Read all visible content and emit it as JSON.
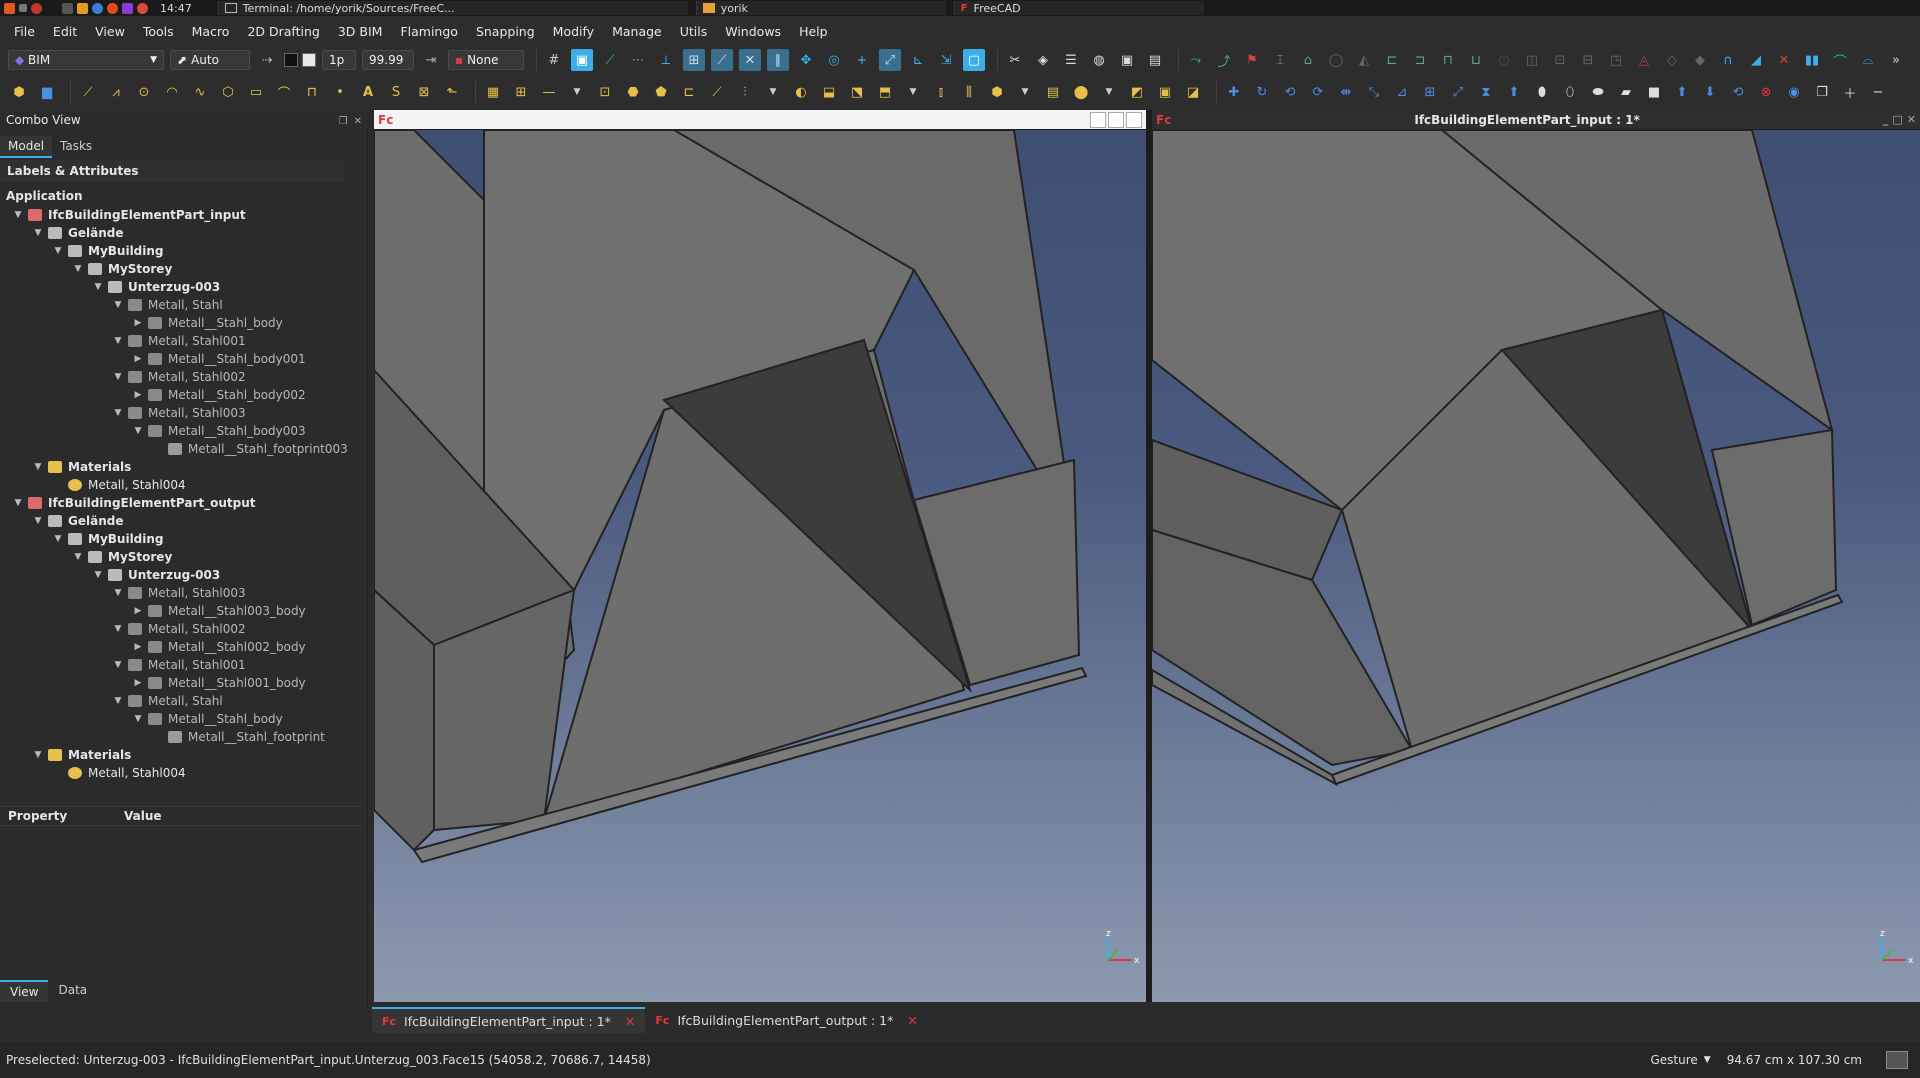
{
  "system": {
    "clock": "14:47",
    "terminal_task": "Terminal: /home/yorik/Sources/FreeC...",
    "folder_task": "yorik",
    "freecad_task": "FreeCAD"
  },
  "menu": [
    "File",
    "Edit",
    "View",
    "Tools",
    "Macro",
    "2D Drafting",
    "3D BIM",
    "Flamingo",
    "Snapping",
    "Modify",
    "Manage",
    "Utils",
    "Windows",
    "Help"
  ],
  "toolbar": {
    "workbench": "BIM",
    "mode": "Auto",
    "line_width": "1p",
    "font_size": "99.99",
    "snap_none": "None"
  },
  "combo_view": {
    "title": "Combo View",
    "tabs": [
      "Model",
      "Tasks"
    ],
    "section_title": "Labels & Attributes",
    "root_label": "Application",
    "tree": [
      {
        "label": "IfcBuildingElementPart_input",
        "level": 0,
        "expanded": true,
        "icon": "document-icon",
        "bold": true
      },
      {
        "label": "Gelände",
        "level": 1,
        "expanded": true,
        "icon": "site-icon",
        "bold": true
      },
      {
        "label": "MyBuilding",
        "level": 2,
        "expanded": true,
        "icon": "building-icon",
        "bold": true
      },
      {
        "label": "MyStorey",
        "level": 3,
        "expanded": true,
        "icon": "storey-icon",
        "bold": true
      },
      {
        "label": "Unterzug-003",
        "level": 4,
        "expanded": true,
        "icon": "beam-icon",
        "bold": true
      },
      {
        "label": "Metall, Stahl",
        "level": 5,
        "expanded": true,
        "icon": "part-icon",
        "bold": false
      },
      {
        "label": "Metall__Stahl_body",
        "level": 6,
        "expanded": false,
        "icon": "solid-icon",
        "bold": false
      },
      {
        "label": "Metall, Stahl001",
        "level": 5,
        "expanded": true,
        "icon": "part-icon",
        "bold": false
      },
      {
        "label": "Metall__Stahl_body001",
        "level": 6,
        "expanded": false,
        "icon": "solid-icon",
        "bold": false
      },
      {
        "label": "Metall, Stahl002",
        "level": 5,
        "expanded": true,
        "icon": "part-icon",
        "bold": false
      },
      {
        "label": "Metall__Stahl_body002",
        "level": 6,
        "expanded": false,
        "icon": "solid-icon",
        "bold": false
      },
      {
        "label": "Metall, Stahl003",
        "level": 5,
        "expanded": true,
        "icon": "part-icon",
        "bold": false
      },
      {
        "label": "Metall__Stahl_body003",
        "level": 6,
        "expanded": true,
        "icon": "solid-icon",
        "bold": false
      },
      {
        "label": "Metall__Stahl_footprint003",
        "level": 7,
        "expanded": null,
        "icon": "face-icon",
        "bold": false
      },
      {
        "label": "Materials",
        "level": 1,
        "expanded": true,
        "icon": "materials-icon",
        "bold": true
      },
      {
        "label": "Metall, Stahl004",
        "level": 2,
        "expanded": null,
        "icon": "material-icon",
        "bold": false
      },
      {
        "label": "IfcBuildingElementPart_output",
        "level": 0,
        "expanded": true,
        "icon": "document-icon",
        "bold": true
      },
      {
        "label": "Gelände",
        "level": 1,
        "expanded": true,
        "icon": "site-icon",
        "bold": true
      },
      {
        "label": "MyBuilding",
        "level": 2,
        "expanded": true,
        "icon": "building-icon",
        "bold": true
      },
      {
        "label": "MyStorey",
        "level": 3,
        "expanded": true,
        "icon": "storey-icon",
        "bold": true
      },
      {
        "label": "Unterzug-003",
        "level": 4,
        "expanded": true,
        "icon": "beam-icon",
        "bold": true
      },
      {
        "label": "Metall, Stahl003",
        "level": 5,
        "expanded": true,
        "icon": "part-icon",
        "bold": false
      },
      {
        "label": "Metall__Stahl003_body",
        "level": 6,
        "expanded": false,
        "icon": "solid-icon",
        "bold": false
      },
      {
        "label": "Metall, Stahl002",
        "level": 5,
        "expanded": true,
        "icon": "part-icon",
        "bold": false
      },
      {
        "label": "Metall__Stahl002_body",
        "level": 6,
        "expanded": false,
        "icon": "solid-icon",
        "bold": false
      },
      {
        "label": "Metall, Stahl001",
        "level": 5,
        "expanded": true,
        "icon": "part-icon",
        "bold": false
      },
      {
        "label": "Metall__Stahl001_body",
        "level": 6,
        "expanded": false,
        "icon": "solid-icon",
        "bold": false
      },
      {
        "label": "Metall, Stahl",
        "level": 5,
        "expanded": true,
        "icon": "part-icon",
        "bold": false
      },
      {
        "label": "Metall__Stahl_body",
        "level": 6,
        "expanded": true,
        "icon": "solid-icon",
        "bold": false
      },
      {
        "label": "Metall__Stahl_footprint",
        "level": 7,
        "expanded": null,
        "icon": "face-icon",
        "bold": false
      },
      {
        "label": "Materials",
        "level": 1,
        "expanded": true,
        "icon": "materials-icon",
        "bold": true
      },
      {
        "label": "Metall, Stahl004",
        "level": 2,
        "expanded": null,
        "icon": "material-icon",
        "bold": false
      }
    ],
    "property_header": {
      "property": "Property",
      "value": "Value"
    },
    "bottom_tabs": [
      "View",
      "Data"
    ]
  },
  "views": {
    "left_title": "",
    "right_title": "IfcBuildingElementPart_input : 1*"
  },
  "doc_tabs": [
    "IfcBuildingElementPart_input : 1*",
    "IfcBuildingElementPart_output : 1*"
  ],
  "status": {
    "preselection": "Preselected: Unterzug-003 - IfcBuildingElementPart_input.Unterzug_003.Face15 (54058.2, 70686.7, 14458)",
    "navigation": "Gesture",
    "dimensions": "94.67 cm x 107.30 cm"
  },
  "colors": {
    "bg": "#2b2b2b",
    "accent": "#3daee9",
    "close_red": "#e0393e"
  }
}
